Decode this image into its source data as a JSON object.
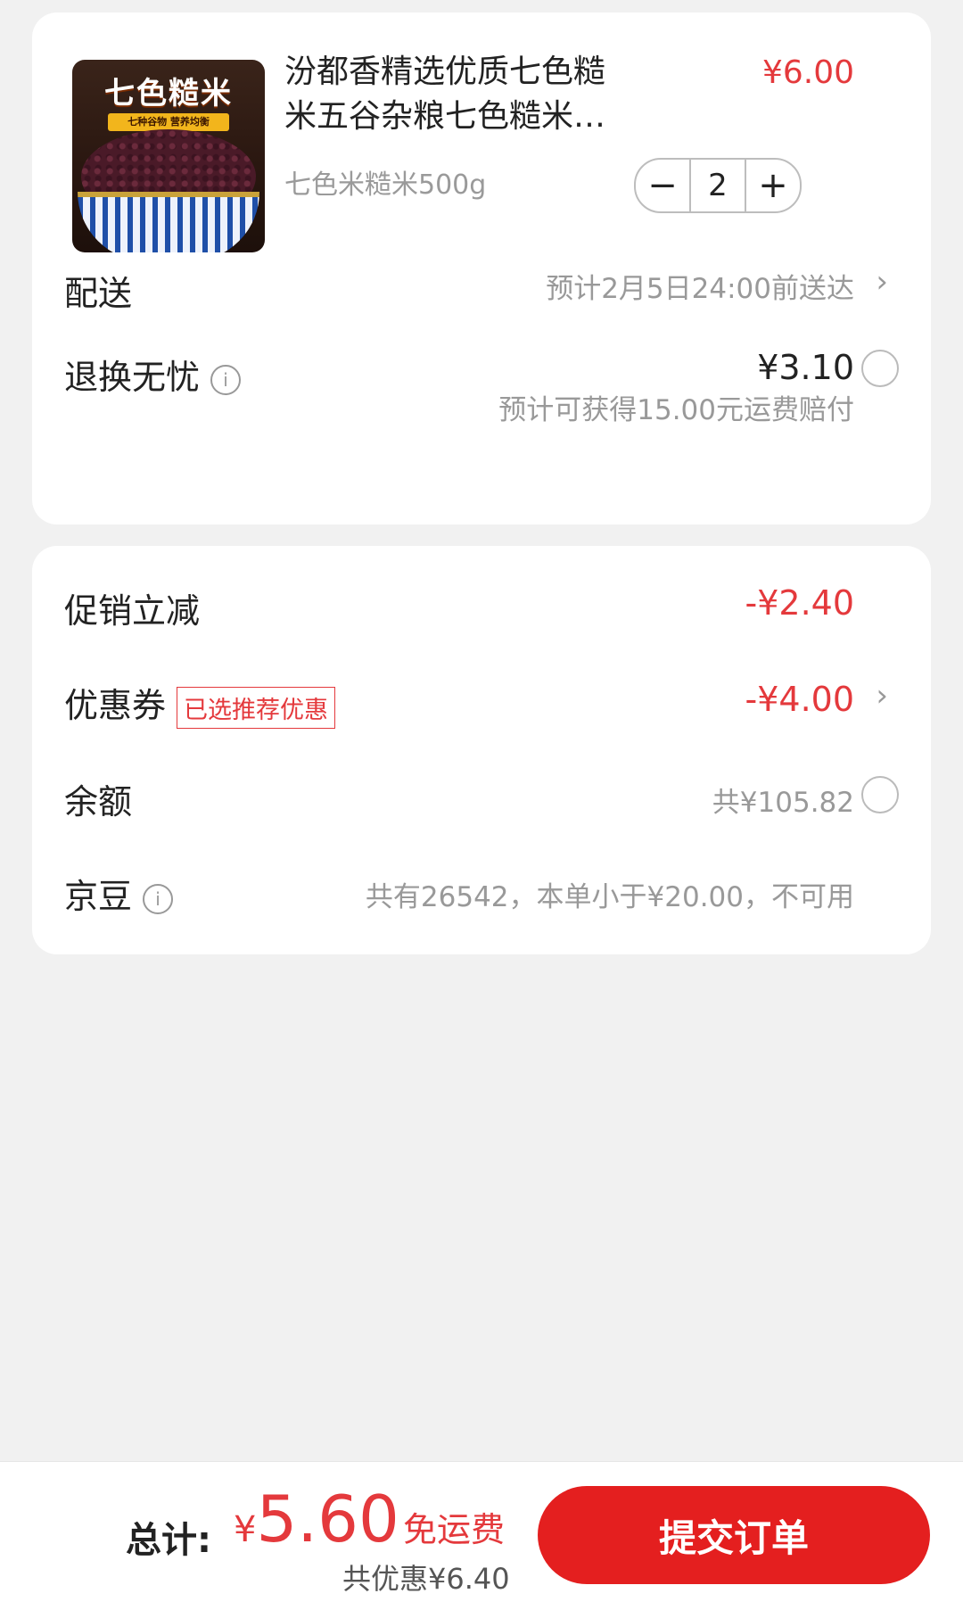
{
  "product": {
    "image_text": "七色糙米",
    "image_subtext": "七种谷物 营养均衡",
    "title_line1": "汾都香精选优质七色糙",
    "title_line2": "米五谷杂粮七色糙米5…",
    "price": "¥6.00",
    "spec": "七色米糙米500g",
    "quantity": "2",
    "minus": "−",
    "plus": "+"
  },
  "delivery": {
    "label": "配送",
    "value": "预计2月5日24:00前送达"
  },
  "return_insurance": {
    "label": "退换无忧",
    "price": "¥3.10",
    "note": "预计可获得15.00元运费赔付"
  },
  "promotion": {
    "label": "促销立减",
    "value": "-¥2.40"
  },
  "coupon": {
    "label": "优惠券",
    "tag": "已选推荐优惠",
    "value": "-¥4.00"
  },
  "balance": {
    "label": "余额",
    "value": "共¥105.82"
  },
  "jingdou": {
    "label": "京豆",
    "value": "共有26542，本单小于¥20.00，不可用"
  },
  "footer": {
    "total_label": "总计:",
    "currency": "¥",
    "total_amount": "5.60",
    "free_shipping": "免运费",
    "discount_total": "共优惠¥6.40",
    "submit_label": "提交订单"
  },
  "icons": {
    "info": "info-circle-icon",
    "chevron": "chevron-right-icon",
    "radio": "radio-unselected"
  },
  "colors": {
    "accent_red": "#e4393c",
    "button_red": "#e41f1f"
  }
}
